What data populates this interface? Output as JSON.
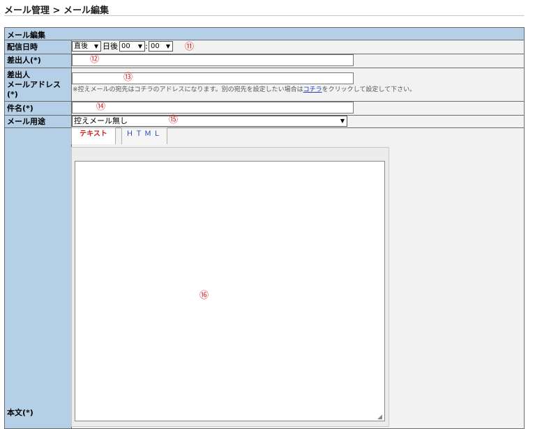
{
  "breadcrumb": "メール管理 > メール編集",
  "form": {
    "section_title": "メール編集",
    "labels": {
      "send_time": "配信日時",
      "sender": "差出人(*)",
      "sender_email_l1": "差出人",
      "sender_email_l2": "メールアドレス",
      "sender_email_l3": "(*)",
      "subject": "件名(*)",
      "usage": "メール用途",
      "body": "本文(*)"
    },
    "send_time": {
      "timing_value": "直後",
      "days_after_label": "日後",
      "hour_value": "00",
      "colon": ":",
      "minute_value": "00"
    },
    "sender_value": "",
    "sender_email_value": "",
    "sender_email_note_prefix": "※控えメールの宛先はコチラのアドレスになります。別の宛先を設定したい場合は",
    "sender_email_note_link": "コチラ",
    "sender_email_note_suffix": "をクリックして設定して下さい。",
    "subject_value": "",
    "usage_value": "控えメール無し",
    "tabs": [
      "テキスト",
      "ＨＴＭＬ"
    ],
    "body_value": ""
  },
  "markers": {
    "m11": "⑪",
    "m12": "⑫",
    "m13": "⑬",
    "m14": "⑭",
    "m15": "⑮",
    "m16": "⑯"
  },
  "icons": {
    "dropdown": "chevron-down-icon",
    "resize": "resize-grip-icon"
  },
  "colors": {
    "label_bg": "#b4cfe6",
    "marker": "#d42020",
    "active_tab": "#d42020",
    "link": "#1a3fbf"
  }
}
